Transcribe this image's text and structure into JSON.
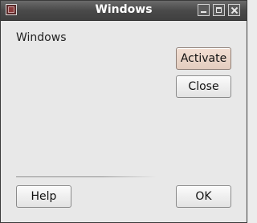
{
  "window": {
    "title": "Windows",
    "icon": "app-icon",
    "controls": [
      "minimize-icon",
      "maximize-icon",
      "close-icon"
    ]
  },
  "content": {
    "label": "Windows"
  },
  "buttons": {
    "activate": "Activate",
    "close": "Close",
    "help": "Help",
    "ok": "OK"
  }
}
